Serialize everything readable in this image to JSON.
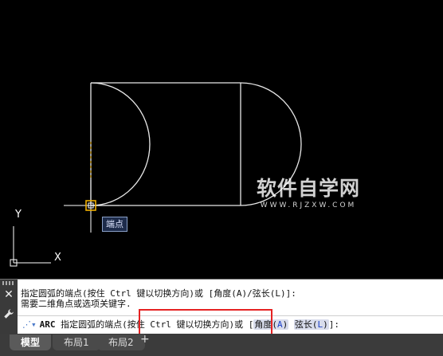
{
  "drawing": {
    "snap_tooltip": "端点",
    "ucs_y_label": "Y",
    "ucs_x_label": "X",
    "watermark_text": "软件自学网",
    "watermark_url": "WWW.RJZXW.COM"
  },
  "command_line": {
    "history_line1": "指定圆弧的端点(按住 Ctrl 键以切换方向)或 [角度(A)/弦长(L)]:",
    "history_line2": "需要二维角点或选项关键字.",
    "prompt_command": "ARC",
    "prompt_text": "指定圆弧的端点(按住 Ctrl 键以切换方向)或 [",
    "option_angle": "角度",
    "option_angle_key": "A",
    "option_chord": "弦长",
    "option_chord_key": "L",
    "prompt_end": "]:",
    "close_icon": "close-icon",
    "customize_icon": "wrench-icon"
  },
  "layout_tabs": [
    {
      "label": "模型",
      "active": true
    },
    {
      "label": "布局1",
      "active": false
    },
    {
      "label": "布局2",
      "active": false
    }
  ],
  "add_tab_label": "+",
  "colors": {
    "canvas_bg": "#000000",
    "geometry": "#e8e8e8",
    "snap_marker": "#f0b000",
    "highlight_box": "#e52222",
    "option_key": "#1a3fc8"
  }
}
